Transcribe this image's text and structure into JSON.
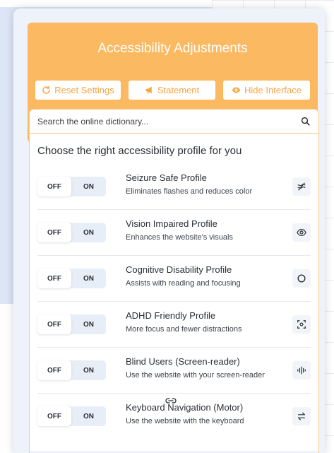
{
  "header": {
    "title": "Accessibility Adjustments",
    "buttons": {
      "reset": "Reset Settings",
      "statement": "Statement",
      "hide": "Hide Interface"
    }
  },
  "search": {
    "placeholder": "Search the online dictionary...",
    "icon": "search-icon"
  },
  "section_title": "Choose the right accessibility profile for you",
  "toggle": {
    "off": "OFF",
    "on": "ON"
  },
  "profiles": [
    {
      "name": "Seizure Safe Profile",
      "desc": "Eliminates flashes and reduces color",
      "icon": "flash-off-icon"
    },
    {
      "name": "Vision Impaired Profile",
      "desc": "Enhances the website's visuals",
      "icon": "eye-icon"
    },
    {
      "name": "Cognitive Disability Profile",
      "desc": "Assists with reading and focusing",
      "icon": "circle-icon"
    },
    {
      "name": "ADHD Friendly Profile",
      "desc": "More focus and fewer distractions",
      "icon": "focus-target-icon"
    },
    {
      "name": "Blind Users (Screen-reader)",
      "desc": "Use the website with your screen-reader",
      "icon": "audio-waveform-icon"
    },
    {
      "name": "Keyboard Navigation (Motor)",
      "desc": "Use the website with the keyboard",
      "icon": "arrows-swap-icon"
    }
  ],
  "colors": {
    "accent": "#fbb962",
    "accent_text": "#f6a540",
    "panel_bg": "#eef3fb"
  }
}
